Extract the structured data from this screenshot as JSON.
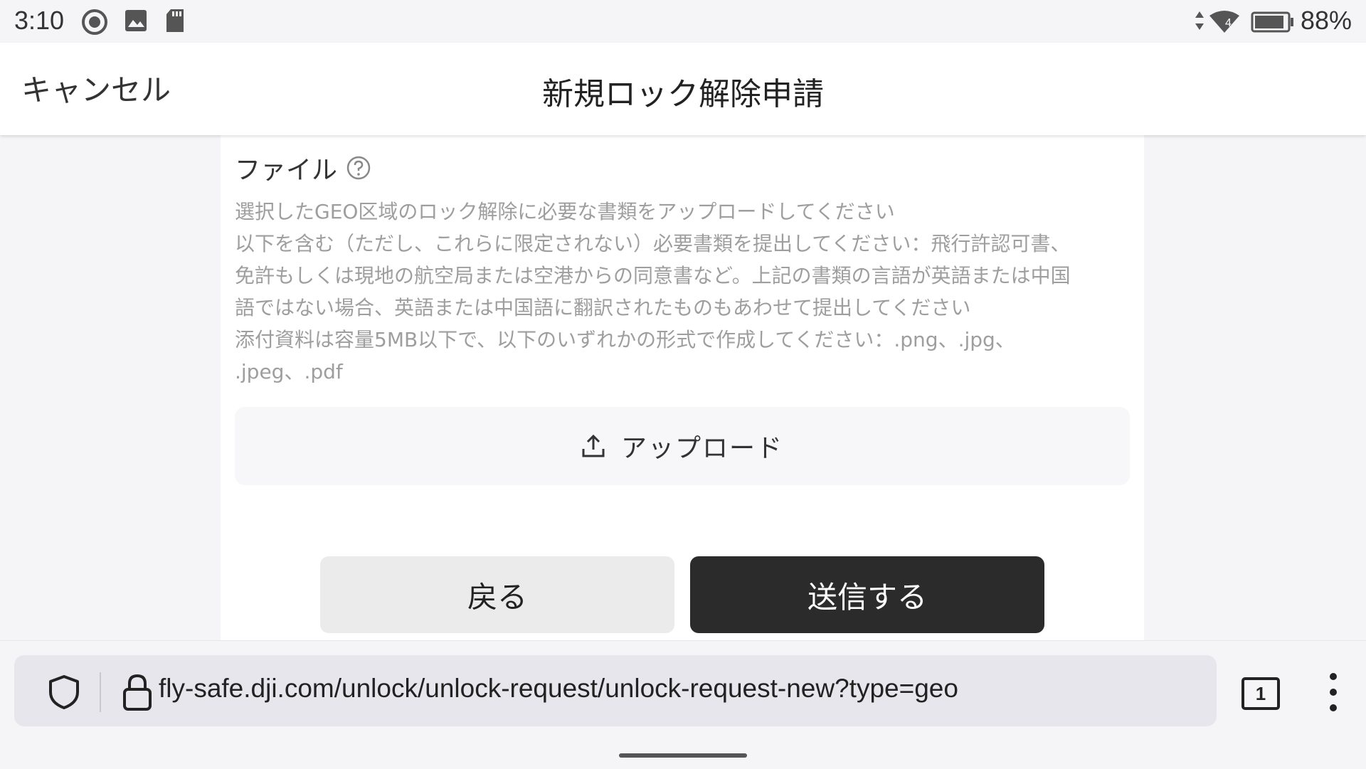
{
  "status_bar": {
    "time": "3:10",
    "battery_percent": "88%",
    "signal_label": "4",
    "icons_left": [
      "record-icon",
      "image-icon",
      "sd-card-icon"
    ],
    "icons_right": [
      "data-arrows-icon",
      "wifi-icon",
      "battery-icon"
    ]
  },
  "header": {
    "cancel_label": "キャンセル",
    "title": "新規ロック解除申請"
  },
  "form": {
    "file_label": "ファイル",
    "description": [
      "選択したGEO区域のロック解除に必要な書類をアップロードしてください",
      "以下を含む（ただし、これらに限定されない）必要書類を提出してください：飛行許認可書、",
      "免許もしくは現地の航空局または空港からの同意書など。上記の書類の言語が英語または中国",
      "語ではない場合、英語または中国語に翻訳されたものもあわせて提出してください",
      "添付資料は容量5MB以下で、以下のいずれかの形式で作成してください：.png、.jpg、",
      ".jpeg、.pdf"
    ],
    "upload_label": "アップロード",
    "back_label": "戻る",
    "submit_label": "送信する"
  },
  "browser": {
    "url": "fly-safe.dji.com/unlock/unlock-request/unlock-request-new?type=geo",
    "tab_count": "1"
  },
  "colors": {
    "primary_button": "#2b2b2b",
    "secondary_button": "#ebebeb",
    "description_text": "#9e9e9e"
  }
}
